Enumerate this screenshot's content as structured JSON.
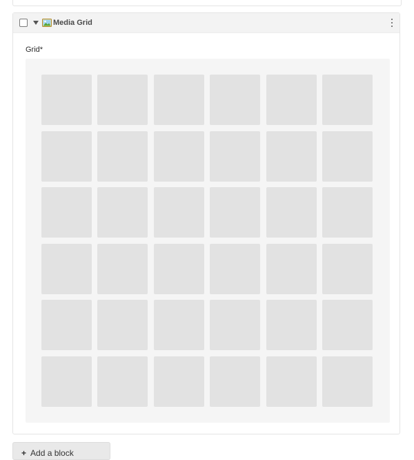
{
  "block": {
    "title": "Media Grid",
    "icon": "image-icon",
    "field_label": "Grid*",
    "menu_icon": "kebab-menu-icon"
  },
  "grid": {
    "rows": 6,
    "columns": 6,
    "cell_color": "#e2e2e2",
    "background_color": "#f5f5f5"
  },
  "add_button": {
    "icon": "+",
    "label": "Add a block"
  }
}
